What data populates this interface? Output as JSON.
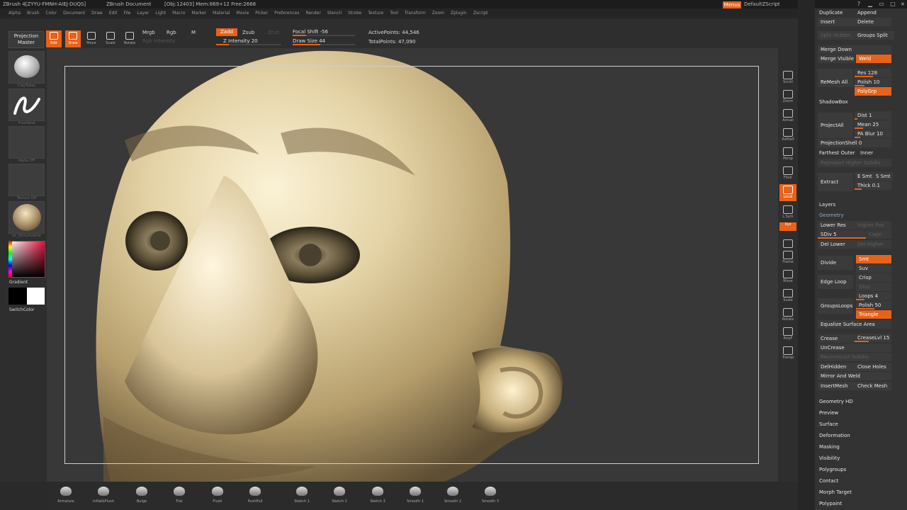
{
  "titlebar": {
    "app": "ZBrush 4[ZYYU-FMNH-AIEJ-DUQS]",
    "doc": "ZBrush Document",
    "obj": "[Obj:12403] Mem:869+12 Free:2668",
    "menus": "Menus",
    "script": "DefaultZScript"
  },
  "menubar": [
    "Alpha",
    "Brush",
    "Color",
    "Document",
    "Draw",
    "Edit",
    "File",
    "Layer",
    "Light",
    "Macro",
    "Marker",
    "Material",
    "Movie",
    "Picker",
    "Preferences",
    "Render",
    "Stencil",
    "Stroke",
    "Texture",
    "Tool",
    "Transform",
    "Zoom",
    "Zplugin",
    "Zscript"
  ],
  "top": {
    "projection_master": "Projection Master",
    "edit": "Edit",
    "draw": "Draw",
    "move": "Move",
    "scale": "Scale",
    "rotate": "Rotate",
    "mrgb": "Mrgb",
    "rgb": "Rgb",
    "m": "M",
    "rgb_intensity": "Rgb Intensity",
    "zadd": "Zadd",
    "zsub": "Zsub",
    "zcut": "Zcut",
    "z_intensity": "Z Intensity 20",
    "focal_shift": "Focal Shift -56",
    "draw_size": "Draw Size 44",
    "active_points": "ActivePoints: 44,546",
    "total_points": "TotalPoints: 47,090",
    "z_intensity_level": 0.2,
    "draw_size_level": 0.44,
    "focal_shift_level": 0.22
  },
  "left": {
    "brush_label": "ClayTubes",
    "stroke_label": "FreeHand",
    "alpha_label": "Alpha Off",
    "texture_label": "Texture Off",
    "material_label": "im_ShinyOutline",
    "gradient": "Gradient",
    "switchcolor": "SwitchColor"
  },
  "righttools": [
    "Scroll",
    "Zoom",
    "Actual",
    "AAHalf",
    "Persp",
    "Floor",
    "Local",
    "L.Sym",
    "Xyz",
    "",
    "Frame",
    "Move",
    "Scale",
    "Rotate",
    "PolyF",
    "Transp"
  ],
  "panel": {
    "duplicate": "Duplicate",
    "append": "Append",
    "insert": "Insert",
    "delete": "Delete",
    "split_hidden": "Split Hidden",
    "groups_split": "Groups Split",
    "merge_down": "Merge Down",
    "merge_visible": "Merge Visible",
    "weld": "Weld",
    "remesh_all": "ReMesh All",
    "res": "Res 128",
    "polish": "Polish 10",
    "polygrp": "PolyGrp",
    "shadowbox": "ShadowBox",
    "project_all": "ProjectAll",
    "dist": "Dist 1",
    "mean": "Mean 25",
    "pa_blur": "PA Blur 10",
    "projection_shell": "ProjectionShell 0",
    "farthest_outer": "Farthest Outer",
    "inner": "Inner",
    "reproject": "Reproject Higher Subdiv",
    "extract": "Extract",
    "e_smt": "E Smt 5",
    "s_smt": "S Smt",
    "thick": "Thick 0.1",
    "layers": "Layers",
    "geometry": "Geometry",
    "lower_res": "Lower Res",
    "higher_res": "Higher Res",
    "sdiv": "SDiv 5",
    "cage": "Cage",
    "del_lower": "Del Lower",
    "del_higher": "Del Higher",
    "divide": "Divide",
    "smt": "Smt",
    "suv": "Suv",
    "edge_loop": "Edge Loop",
    "crisp": "Crisp",
    "disp": "Disp",
    "loops": "Loops 4",
    "groups_loops": "GroupsLoops",
    "polish2": "Polish 50",
    "triangle": "Triangle",
    "equalize": "Equalize Surface Area",
    "crease": "Crease",
    "crease_lvl": "CreaseLvl 15",
    "uncrease": "UnCrease",
    "reconstruct": "Reconstruct Subdiv",
    "del_hidden": "DelHidden",
    "close_holes": "Close Holes",
    "mirror_weld": "Mirror And Weld",
    "insert_mesh": "InsertMesh",
    "check_mesh": "Check Mesh",
    "sections": [
      "Geometry HD",
      "Preview",
      "Surface",
      "Deformation",
      "Masking",
      "Visibility",
      "Polygroups",
      "Contact",
      "Morph Target",
      "Polypaint"
    ]
  },
  "bottom": [
    "Armature",
    "Inflat&Flush",
    "Bulge",
    "Flat",
    "Flush",
    "PushPull",
    "Sketch 1",
    "Sketch 2",
    "Sketch 3",
    "Smooth 1",
    "Smooth 2",
    "Smooth 3"
  ]
}
